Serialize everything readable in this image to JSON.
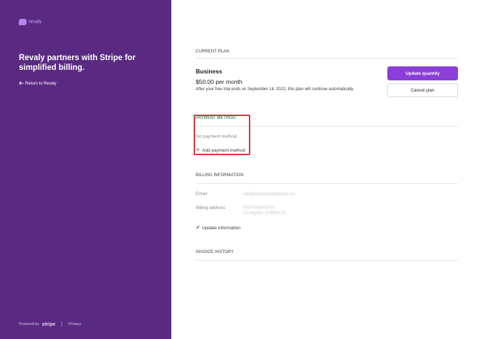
{
  "sidebar": {
    "logo_text": "revaly",
    "headline": "Revaly partners with Stripe for simplified billing.",
    "return_link": "Return to Revaly",
    "footer": {
      "powered_by": "Powered by",
      "stripe": "stripe",
      "privacy": "Privacy"
    }
  },
  "current_plan": {
    "section_title": "CURRENT PLAN",
    "name": "Business",
    "price": "$50.00 per month",
    "note": "After your free trial ends on September 14, 2022, this plan will continue automatically.",
    "update_quantity": "Update quantity",
    "cancel_plan": "Cancel plan"
  },
  "payment_method": {
    "section_title": "PAYMENT METHOD",
    "empty_text": "No payment method.",
    "add_link": "Add payment method"
  },
  "billing_information": {
    "section_title": "BILLING INFORMATION",
    "email_label": "Email",
    "email_value": "mike@hollywoodsignprinting.com",
    "address_label": "Billing address",
    "address_line1": "6711 Hollywood Ave",
    "address_line2": "Los Angeles, CA 90028 US",
    "update_link": "Update information"
  },
  "invoice_history": {
    "section_title": "INVOICE HISTORY"
  },
  "colors": {
    "sidebar_bg": "#5a2a83",
    "primary_button": "#8b3fd6",
    "highlight": "#d8323c"
  }
}
